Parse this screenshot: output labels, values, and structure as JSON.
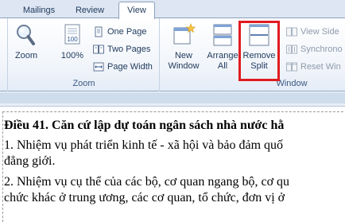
{
  "tabs": [
    {
      "label": "Mailings",
      "active": false
    },
    {
      "label": "Review",
      "active": false
    },
    {
      "label": "View",
      "active": true
    }
  ],
  "ribbon": {
    "zoom_group": {
      "label": "Zoom",
      "zoom_button": "Zoom",
      "hundred_button": "100%",
      "one_page": "One Page",
      "two_pages": "Two Pages",
      "page_width": "Page Width"
    },
    "window_group": {
      "label": "Window",
      "new_window": [
        "New",
        "Window"
      ],
      "arrange_all": [
        "Arrange",
        "All"
      ],
      "remove_split": [
        "Remove",
        "Split"
      ],
      "view_side": "View Side",
      "synchronous": "Synchrono",
      "reset_window": "Reset Win"
    },
    "highlight_color": "#e11b22"
  },
  "document": {
    "heading": "Điều 41. Căn cứ lập dự toán ngân sách nhà nước hằ",
    "para1": [
      "1. Nhiệm vụ phát triển kinh tế - xã hội và bảo đảm quố",
      "đẳng giới."
    ],
    "para2": [
      "2. Nhiệm vụ cụ thể của các bộ, cơ quan ngang bộ, cơ qu",
      "chức khác ở trung ương, các cơ quan, tổ chức, đơn vị ở"
    ]
  }
}
